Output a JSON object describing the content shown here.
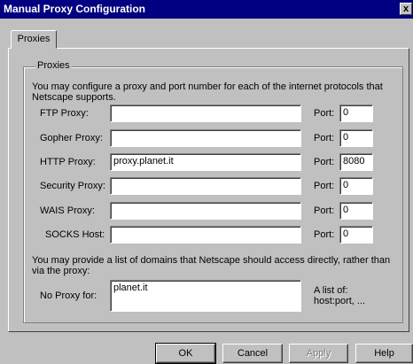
{
  "window": {
    "title": "Manual Proxy Configuration",
    "close": "x"
  },
  "tab": "Proxies",
  "group_title": "Proxies",
  "intro": "You may configure a proxy and port number for each of the internet protocols that Netscape supports.",
  "proxies": [
    {
      "label": "FTP Proxy:",
      "value": "",
      "port": "0"
    },
    {
      "label": "Gopher Proxy:",
      "value": "",
      "port": "0"
    },
    {
      "label": "HTTP Proxy:",
      "value": "proxy.planet.it",
      "port": "8080"
    },
    {
      "label": "Security Proxy:",
      "value": "",
      "port": "0"
    },
    {
      "label": "WAIS Proxy:",
      "value": "",
      "port": "0"
    },
    {
      "label": "SOCKS Host:",
      "value": "",
      "port": "0"
    }
  ],
  "port_label": "Port:",
  "noproxy_text": "You may provide a list of domains that Netscape should access directly, rather than via the proxy:",
  "noproxy_label": "No Proxy for:",
  "noproxy_value": "planet.it",
  "noproxy_hint": "A list of: host:port, ...",
  "buttons": {
    "ok": "OK",
    "cancel": "Cancel",
    "apply": "Apply",
    "help": "Help"
  }
}
